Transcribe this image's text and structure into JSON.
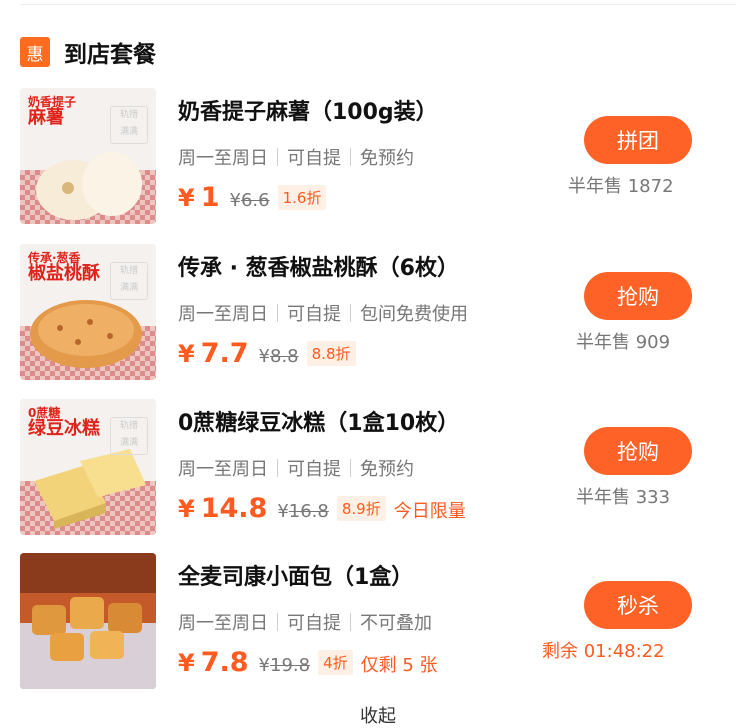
{
  "section": {
    "badge": "惠",
    "title": "到店套餐"
  },
  "items": [
    {
      "thumb_line1": "奶香提子",
      "thumb_line2": "麻薯",
      "watermark": "轨措\n满满",
      "title": "奶香提子麻薯（100g装）",
      "tags": [
        "周一至周日",
        "可自提",
        "免预约"
      ],
      "price": "1",
      "original_price": "6.6",
      "discount": "1.6折",
      "extra": "",
      "button": "拼团",
      "sales": "半年售 1872"
    },
    {
      "thumb_line1": "传承·葱香",
      "thumb_line2": "椒盐桃酥",
      "watermark": "轨措\n满满",
      "title": "传承 · 葱香椒盐桃酥（6枚）",
      "tags": [
        "周一至周日",
        "可自提",
        "包间免费使用"
      ],
      "price": "7.7",
      "original_price": "8.8",
      "discount": "8.8折",
      "extra": "",
      "button": "抢购",
      "sales": "半年售 909"
    },
    {
      "thumb_line1": "0蔗糖",
      "thumb_line2": "绿豆冰糕",
      "watermark": "轨措\n满满",
      "title": "0蔗糖绿豆冰糕（1盒10枚）",
      "tags": [
        "周一至周日",
        "可自提",
        "免预约"
      ],
      "price": "14.8",
      "original_price": "16.8",
      "discount": "8.9折",
      "extra": "今日限量",
      "button": "抢购",
      "sales": "半年售 333"
    },
    {
      "thumb_line1": "",
      "thumb_line2": "",
      "watermark": "",
      "title": "全麦司康小面包（1盒）",
      "tags": [
        "周一至周日",
        "可自提",
        "不可叠加"
      ],
      "price": "7.8",
      "original_price": "19.8",
      "discount": "4折",
      "extra": "仅剩 5 张",
      "button": "秒杀",
      "sales": "剩余 01:48:22"
    }
  ],
  "footer": {
    "label": "收起"
  },
  "colors": {
    "accent": "#ff5a1f",
    "button": "#ff6226"
  }
}
